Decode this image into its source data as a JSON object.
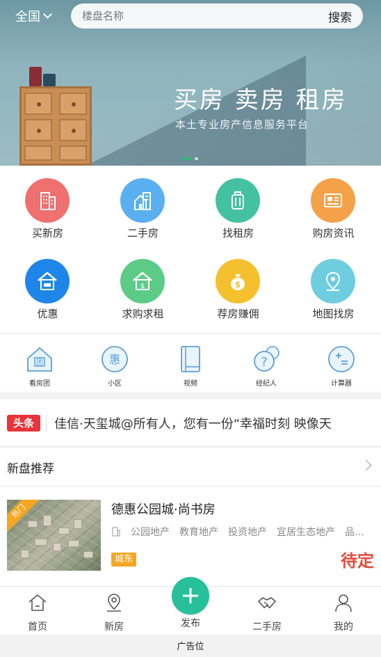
{
  "header": {
    "city": "全国",
    "search_placeholder": "楼盘名称",
    "search_button": "搜索"
  },
  "banner": {
    "title": "买房 卖房 租房",
    "subtitle": "本土专业房产信息服务平台",
    "slide_count": 2,
    "active_slide": 1
  },
  "grid": [
    {
      "label": "买新房",
      "icon": "building-icon",
      "color": "#f0706f"
    },
    {
      "label": "二手房",
      "icon": "house-building-icon",
      "color": "#5aaff0"
    },
    {
      "label": "找租房",
      "icon": "suitcase-icon",
      "color": "#43c1a0"
    },
    {
      "label": "购房资讯",
      "icon": "news-icon",
      "color": "#f5a14a"
    },
    {
      "label": "优惠",
      "icon": "house-coupon-icon",
      "color": "#1e86e8"
    },
    {
      "label": "求购求租",
      "icon": "house-money-icon",
      "color": "#5ccb87"
    },
    {
      "label": "荐房赚佣",
      "icon": "money-bag-icon",
      "color": "#f5c02d"
    },
    {
      "label": "地图找房",
      "icon": "map-pin-icon",
      "color": "#6fcde0"
    }
  ],
  "small_icons": [
    {
      "label": "看房团",
      "icon": "group-house-icon"
    },
    {
      "label": "小区",
      "icon": "hui-icon"
    },
    {
      "label": "视频",
      "icon": "video-book-icon"
    },
    {
      "label": "经纪人",
      "icon": "agent-question-icon"
    },
    {
      "label": "计算器",
      "icon": "calculator-icon"
    }
  ],
  "news": {
    "badge": "头条",
    "text": "佳信·天玺城@所有人，您有一份“幸福时刻 映像天"
  },
  "section": {
    "title": "新盘推荐"
  },
  "listing": {
    "hot_label": "热门",
    "title": "德惠公园城·尚书房",
    "tags": [
      "公园地产",
      "教育地产",
      "投资地产",
      "宜居生态地产",
      "品..."
    ],
    "district": "城东",
    "price": "待定"
  },
  "nav": {
    "items": [
      {
        "label": "首页",
        "icon": "home-icon"
      },
      {
        "label": "新房",
        "icon": "location-icon"
      },
      {
        "label": "发布",
        "icon": "plus-icon"
      },
      {
        "label": "二手房",
        "icon": "handshake-icon"
      },
      {
        "label": "我的",
        "icon": "user-icon"
      }
    ]
  },
  "ad": {
    "label": "广告位"
  }
}
